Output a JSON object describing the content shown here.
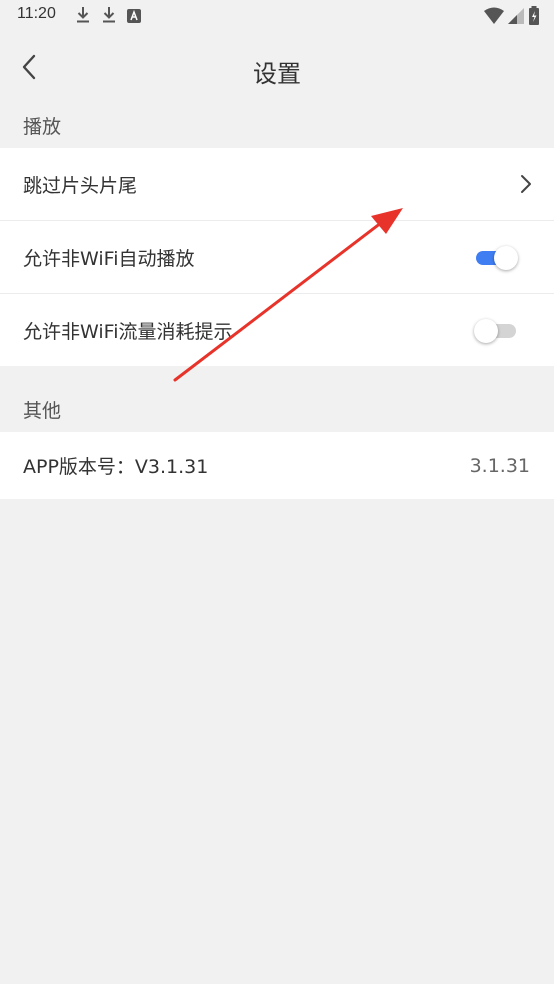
{
  "status_bar": {
    "time": "11:20",
    "left_icons": [
      "download-icon",
      "download-icon",
      "a-notification-icon"
    ],
    "right_icons": [
      "wifi-icon",
      "signal-icon",
      "battery-icon"
    ]
  },
  "header": {
    "title": "设置",
    "back_icon": "chevron-left-icon"
  },
  "sections": [
    {
      "title": "播放",
      "rows": [
        {
          "label": "跳过片头片尾",
          "type": "link"
        },
        {
          "label": "允许非WiFi自动播放",
          "type": "toggle",
          "state": "on"
        },
        {
          "label": "允许非WiFi流量消耗提示",
          "type": "toggle",
          "state": "off"
        }
      ]
    },
    {
      "title": "其他",
      "rows": [
        {
          "label": "APP版本号：V3.1.31",
          "type": "value",
          "value": "3.1.31"
        }
      ]
    }
  ],
  "colors": {
    "background": "#f1f1f1",
    "card": "#ffffff",
    "toggle_on": "#3f7ef2",
    "toggle_off": "#d4d4d4",
    "annotation_arrow": "#e8332a"
  }
}
